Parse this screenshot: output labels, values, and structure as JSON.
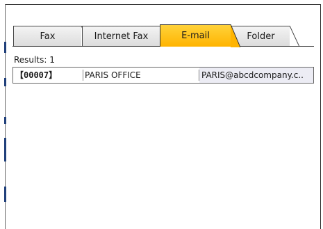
{
  "tabs": [
    {
      "label": "Fax",
      "active": false
    },
    {
      "label": "Internet Fax",
      "active": false
    },
    {
      "label": "E-mail",
      "active": true
    },
    {
      "label": "Folder",
      "active": false
    }
  ],
  "results": {
    "label": "Results: 1"
  },
  "entries": [
    {
      "id": "【00007】",
      "name": "PARIS OFFICE",
      "email": "PARIS@abcdcompany.c.."
    }
  ],
  "colors": {
    "active_tab": "#ffb400",
    "edge_marks": "#1f3f7a"
  }
}
